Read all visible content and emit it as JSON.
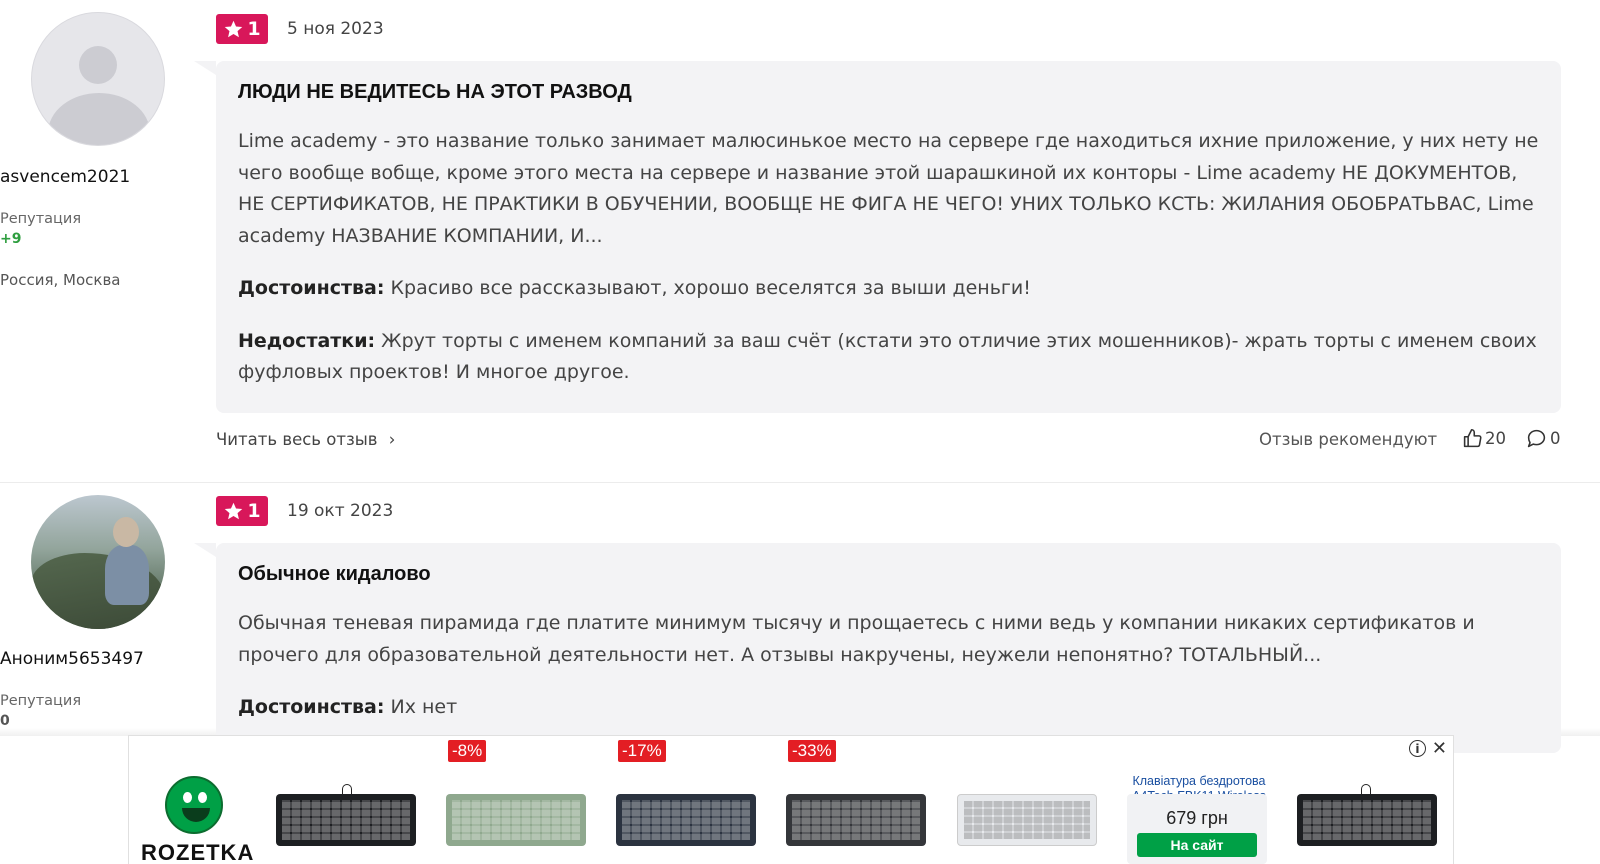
{
  "reviews": [
    {
      "author": "asvencem2021",
      "reputation_label": "Репутация",
      "reputation_value": "+9",
      "location": "Россия, Москва",
      "rating": "1",
      "date": "5 ноя 2023",
      "title": "ЛЮДИ НЕ ВЕДИТЕСЬ НА ЭТОТ РАЗВОД",
      "text": "Lime academy - это название только занимает малюсинькое место на сервере где находиться ихние приложение, у них нету не чего вообще вобще, кроме этого места на сервере и название этой шарашкиной их конторы - Lime academy НЕ ДОКУМЕНТОВ, НЕ СЕРТИФИКАТОВ, НЕ ПРАКТИКИ В ОБУЧЕНИИ, ВООБЩЕ НЕ ФИГА НЕ ЧЕГО! УНИХ ТОЛЬКО КСТЬ: ЖИЛАНИЯ ОБОБРАТЬВАС, Lime academy НАЗВАНИЕ КОМПАНИИ, И...",
      "pros_label": "Достоинства:",
      "pros": "Красиво все рассказывают, хорошо веселятся за выши деньги!",
      "cons_label": "Недостатки:",
      "cons": "Жрут торты с именем компаний за ваш счёт (кстати это отличие этих мошенников)- жрать торты с именем своих фуфловых проектов! И многое другое.",
      "read_more": "Читать весь отзыв",
      "recommend_label": "Отзыв рекомендуют",
      "likes": "20",
      "comments": "0"
    },
    {
      "author": "Аноним5653497",
      "reputation_label": "Репутация",
      "reputation_value": "0",
      "rating": "1",
      "date": "19 окт 2023",
      "title": "Обычное кидалово",
      "text": "Обычная теневая пирамида где платите минимум тысячу и прощаетесь с ними ведь у компании никаких сертификатов и прочего для образовательной деятельности нет. А отзывы накручены, неужели непонятно? ТОТАЛЬНЫЙ...",
      "pros_label": "Достоинства:",
      "pros": "Их нет"
    }
  ],
  "ad": {
    "brand": "ROZETKA",
    "products": [
      {
        "discount": ""
      },
      {
        "discount": "-8%"
      },
      {
        "discount": "-17%"
      },
      {
        "discount": "-33%"
      },
      {
        "discount": ""
      },
      {
        "title": "Клавіатура бездротова A4Tech FBK11 Wireless",
        "price": "679 грн",
        "button": "На сайт"
      },
      {
        "discount": ""
      }
    ]
  },
  "colors": {
    "accent": "#d8175a",
    "positive": "#2e9e3f",
    "ad_green": "#00a046",
    "discount": "#e31e24"
  }
}
